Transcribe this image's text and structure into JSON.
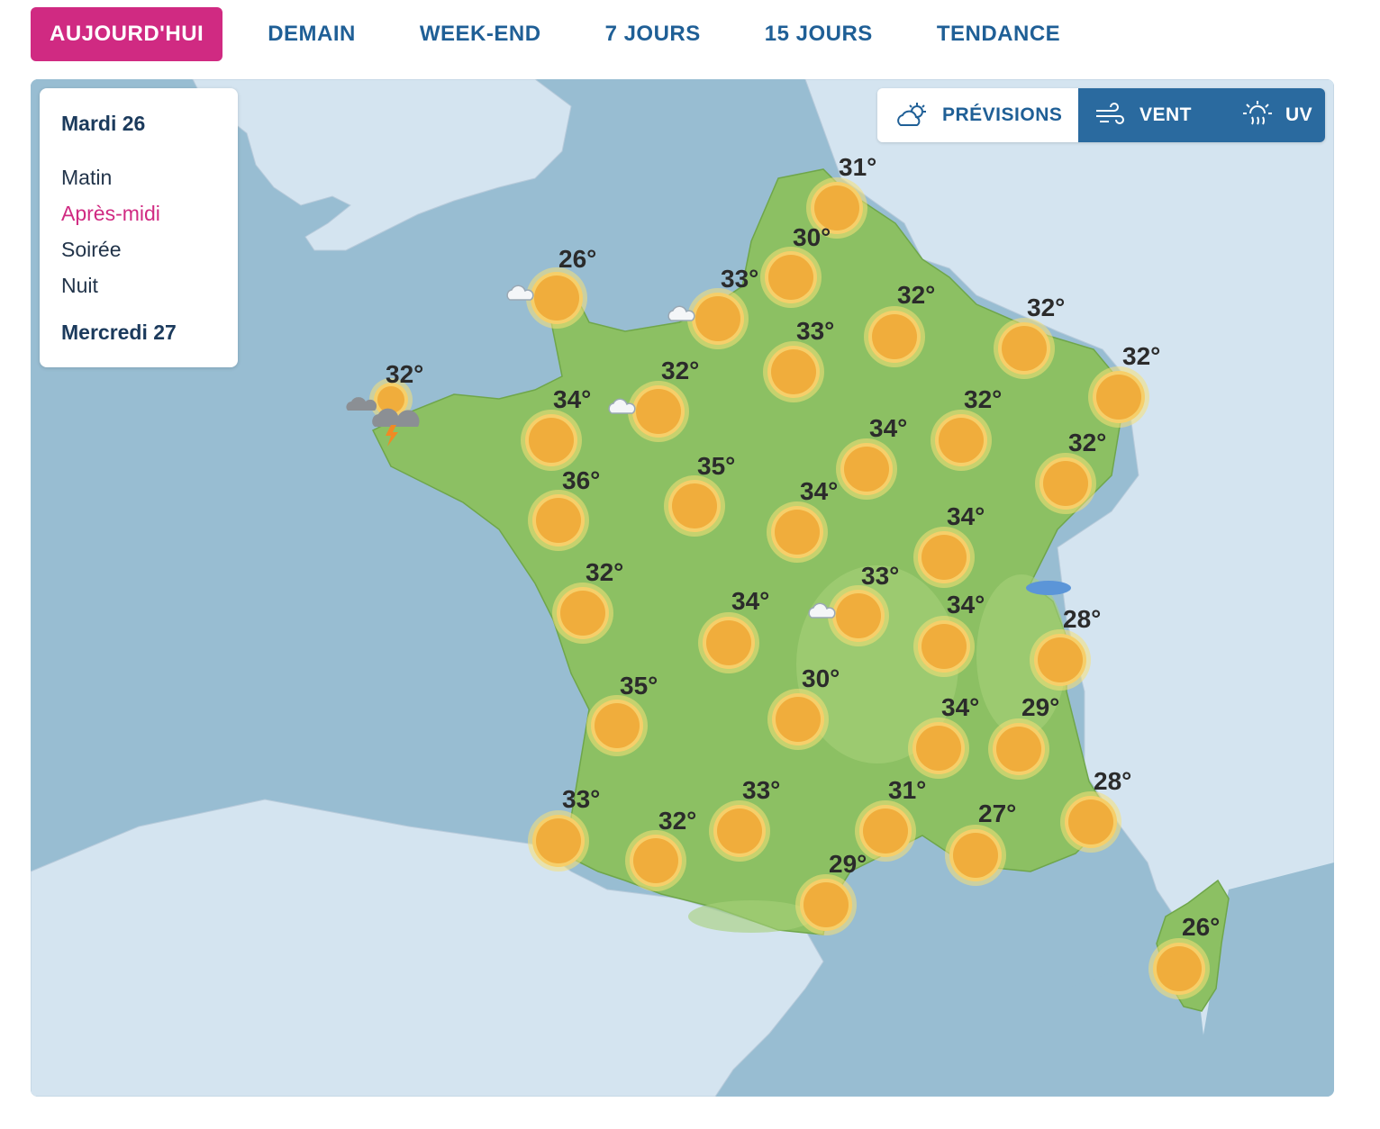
{
  "tabs": [
    {
      "label": "AUJOURD'HUI",
      "active": true
    },
    {
      "label": "DEMAIN"
    },
    {
      "label": "WEEK-END"
    },
    {
      "label": "7 JOURS"
    },
    {
      "label": "15 JOURS"
    },
    {
      "label": "TENDANCE"
    }
  ],
  "panel": {
    "day1": "Mardi 26",
    "periods": [
      {
        "label": "Matin"
      },
      {
        "label": "Après-midi",
        "active": true
      },
      {
        "label": "Soirée"
      },
      {
        "label": "Nuit"
      }
    ],
    "day2": "Mercredi 27"
  },
  "layers": {
    "previsions": "PRÉVISIONS",
    "vent": "VENT",
    "uv": "UV",
    "icons": {
      "previsions": "partly-cloudy-icon",
      "vent": "wind-icon",
      "uv": "uv-sun-icon"
    }
  },
  "colors": {
    "accent": "#d02a82",
    "brand_blue": "#1f5f96",
    "sea": "#98bdd2",
    "land_other": "#d4e4f0",
    "france": "#8cc063",
    "sun": "#f0ad3c"
  },
  "cities": [
    {
      "temp": "31°",
      "icon": "sun"
    },
    {
      "temp": "30°",
      "icon": "sun"
    },
    {
      "temp": "26°",
      "icon": "sun-cloud"
    },
    {
      "temp": "33°",
      "icon": "sun-cloud"
    },
    {
      "temp": "32°",
      "icon": "sun"
    },
    {
      "temp": "32°",
      "icon": "sun"
    },
    {
      "temp": "33°",
      "icon": "sun"
    },
    {
      "temp": "32°",
      "icon": "sun"
    },
    {
      "temp": "32°",
      "icon": "storm"
    },
    {
      "temp": "34°",
      "icon": "sun"
    },
    {
      "temp": "32°",
      "icon": "sun-cloud"
    },
    {
      "temp": "32°",
      "icon": "sun"
    },
    {
      "temp": "34°",
      "icon": "sun"
    },
    {
      "temp": "32°",
      "icon": "sun"
    },
    {
      "temp": "36°",
      "icon": "sun"
    },
    {
      "temp": "35°",
      "icon": "sun"
    },
    {
      "temp": "34°",
      "icon": "sun"
    },
    {
      "temp": "34°",
      "icon": "sun"
    },
    {
      "temp": "32°",
      "icon": "sun"
    },
    {
      "temp": "33°",
      "icon": "sun-cloud"
    },
    {
      "temp": "34°",
      "icon": "sun"
    },
    {
      "temp": "34°",
      "icon": "sun"
    },
    {
      "temp": "28°",
      "icon": "sun"
    },
    {
      "temp": "35°",
      "icon": "sun"
    },
    {
      "temp": "30°",
      "icon": "sun"
    },
    {
      "temp": "34°",
      "icon": "sun"
    },
    {
      "temp": "29°",
      "icon": "sun"
    },
    {
      "temp": "33°",
      "icon": "sun"
    },
    {
      "temp": "32°",
      "icon": "sun"
    },
    {
      "temp": "33°",
      "icon": "sun"
    },
    {
      "temp": "31°",
      "icon": "sun"
    },
    {
      "temp": "27°",
      "icon": "sun"
    },
    {
      "temp": "28°",
      "icon": "sun"
    },
    {
      "temp": "29°",
      "icon": "sun"
    },
    {
      "temp": "26°",
      "icon": "sun"
    }
  ]
}
